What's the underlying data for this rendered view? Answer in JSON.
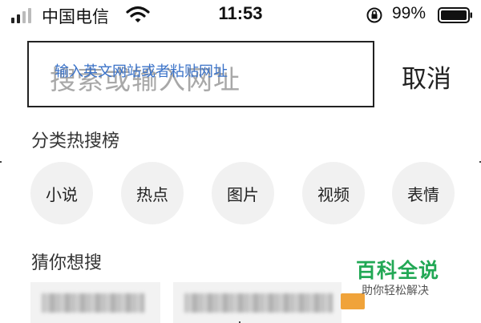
{
  "status_bar": {
    "carrier": "中国电信",
    "time": "11:53",
    "battery_percent": "99%",
    "icons": [
      "signal-icon",
      "wifi-icon",
      "orientation-lock-icon",
      "battery-icon"
    ]
  },
  "search": {
    "placeholder": "搜索或输入网址",
    "hint": "输入英文网站或者粘贴网址",
    "cancel_label": "取消"
  },
  "categories": {
    "title": "分类热搜榜",
    "items": [
      {
        "label": "小说"
      },
      {
        "label": "热点"
      },
      {
        "label": "图片"
      },
      {
        "label": "视频"
      },
      {
        "label": "表情"
      }
    ]
  },
  "guess": {
    "title": "猜你想搜"
  },
  "watermark": {
    "title": "百科全说",
    "subtitle": "助你轻松解决"
  },
  "colors": {
    "hint_blue": "#3a72c8",
    "watermark_green": "#22a855",
    "chip_bg": "#f1f1f1"
  }
}
